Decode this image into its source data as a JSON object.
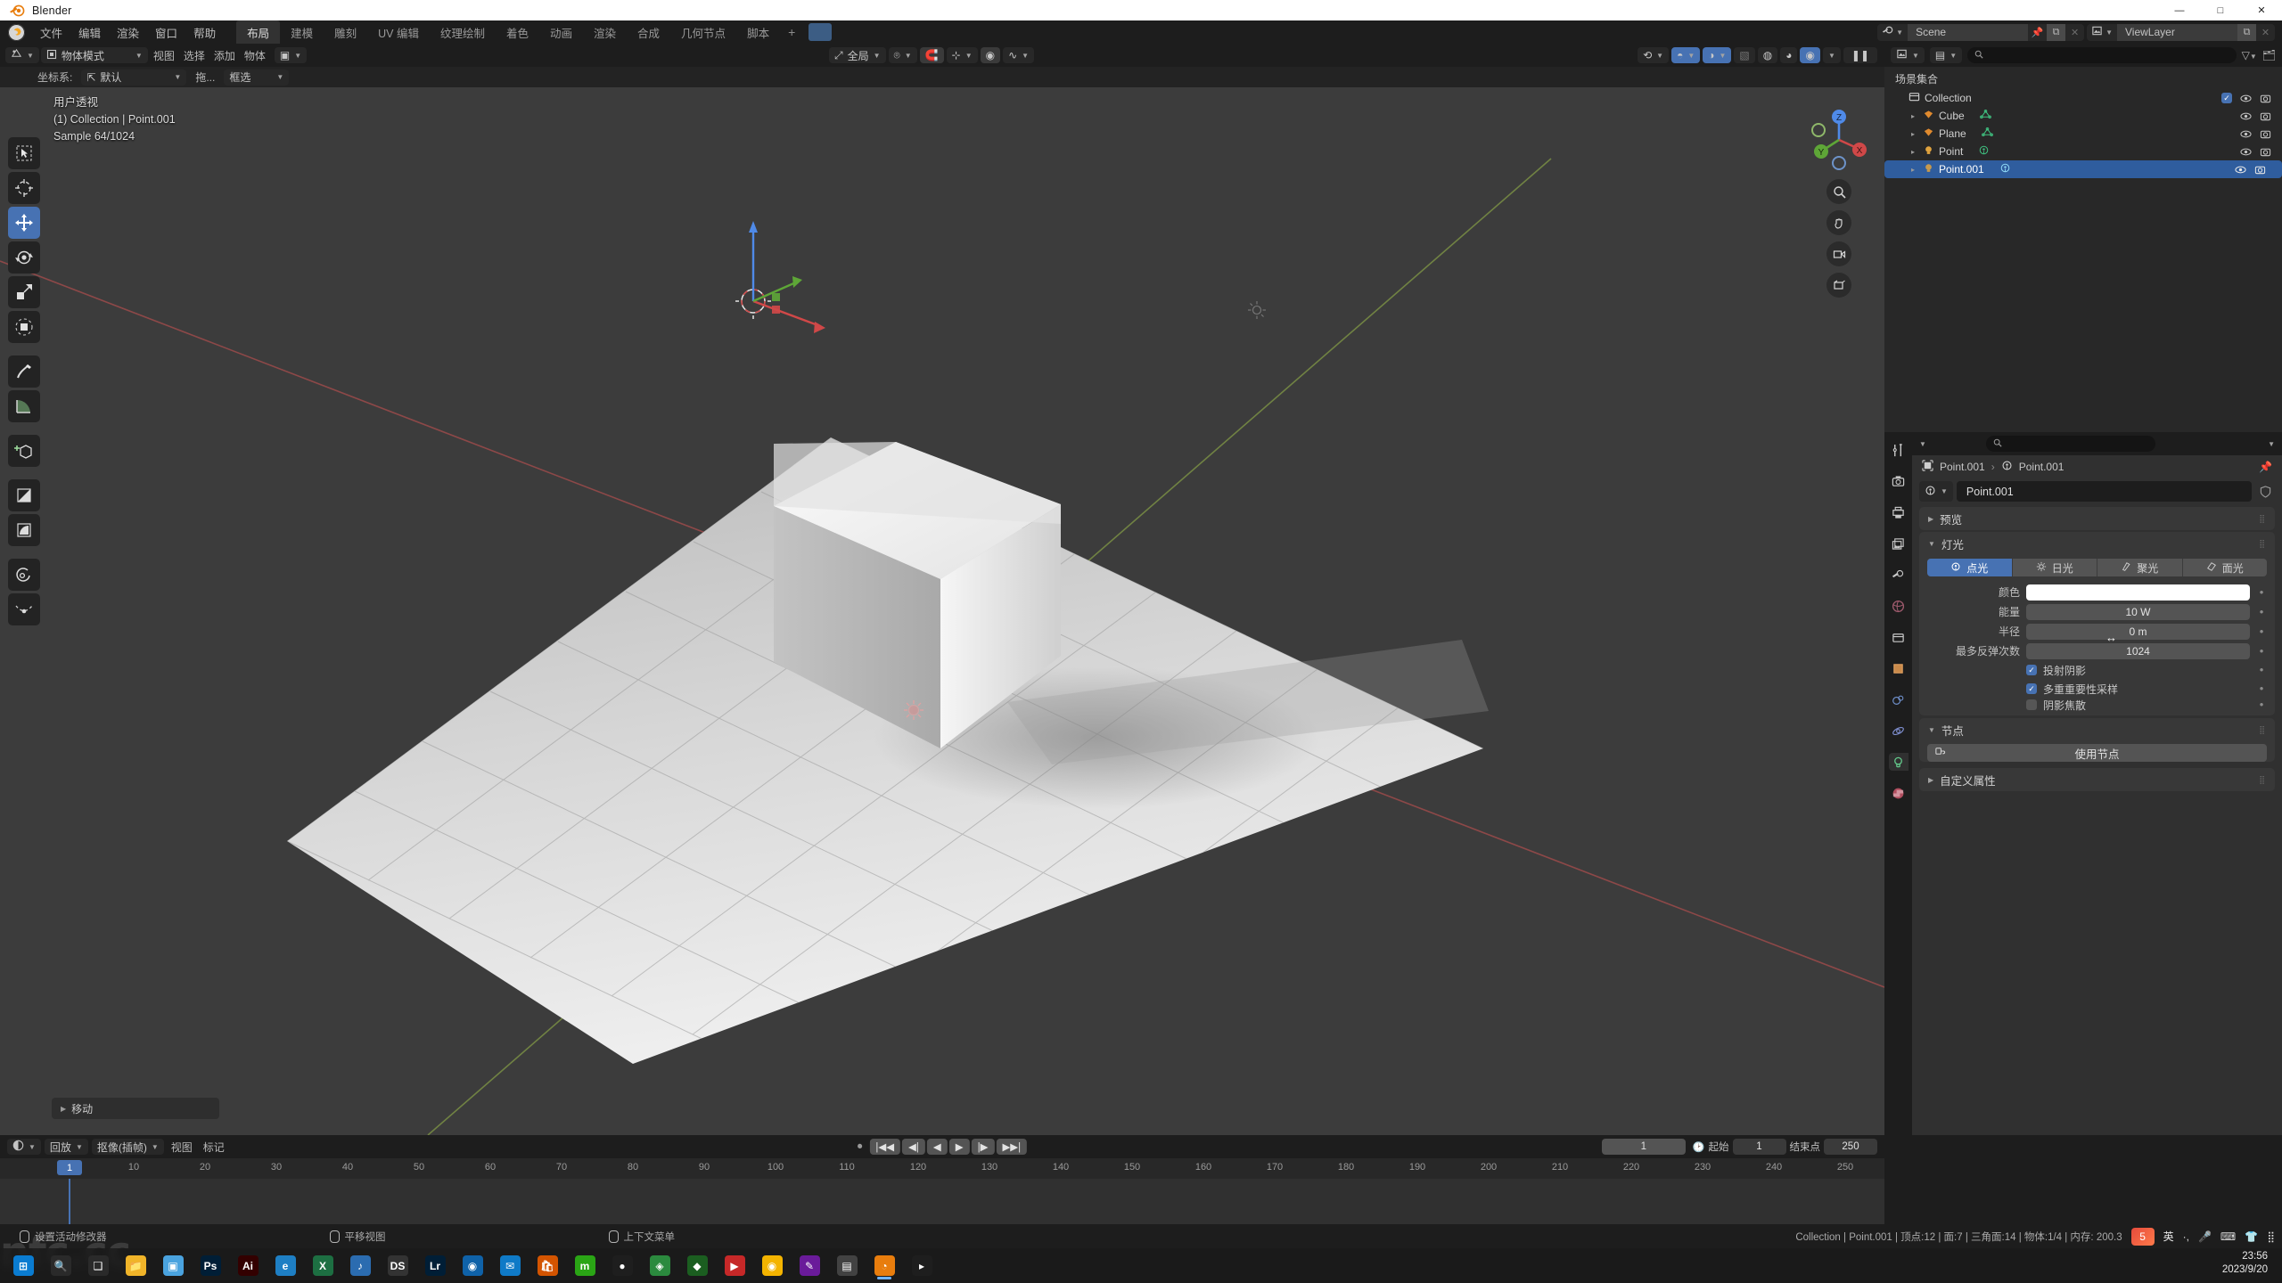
{
  "window": {
    "app_title": "Blender",
    "min": "—",
    "max": "□",
    "close": "✕"
  },
  "topbar": {
    "menus": [
      "文件",
      "编辑",
      "渲染",
      "窗口",
      "帮助"
    ],
    "workspaces": [
      "布局",
      "建模",
      "雕刻",
      "UV 编辑",
      "纹理绘制",
      "着色",
      "动画",
      "渲染",
      "合成",
      "几何节点",
      "脚本"
    ],
    "active_workspace": "布局",
    "add_workspace": "+",
    "scene_name": "Scene",
    "viewlayer_name": "ViewLayer",
    "scene_icon": "scene-icon",
    "viewlayer_icon": "viewlayer-icon",
    "pin_icon": "pin-icon",
    "copy_icon": "duplicate-icon",
    "x_icon": "unlink-icon"
  },
  "viewport": {
    "header": {
      "editor_type": "editor-type-3dview",
      "mode": "物体模式",
      "menus": [
        "视图",
        "选择",
        "添加",
        "物体"
      ],
      "transform_orientation": "全局",
      "snap_icon": "magnet-icon",
      "proportional_icon": "proportional-edit-icon"
    },
    "tool_header": {
      "orient_label": "坐标系:",
      "orient_value": "默认",
      "drag_label": "拖...",
      "drag_value": "框选"
    },
    "shading": {
      "overlays_icon": "overlays-icon",
      "xray_icon": "xray-icon",
      "gizmo_icon": "gizmo-icon",
      "wireframe_icon": "shading-wireframe",
      "solid_icon": "shading-solid",
      "material_icon": "shading-material",
      "rendered_icon": "shading-rendered",
      "pause_icon": "pause-render-icon"
    },
    "overlay_text": {
      "view_name": "用户透视",
      "collection_object": "(1) Collection | Point.001",
      "samples": "Sample 64/1024"
    },
    "tools": [
      {
        "name": "tweak-tool",
        "icon": "cursor-select-box",
        "active": false
      },
      {
        "name": "cursor-tool",
        "icon": "3d-cursor",
        "active": false
      },
      {
        "name": "move-tool",
        "icon": "move-arrows",
        "active": true
      },
      {
        "name": "rotate-tool",
        "icon": "rotate-arrows",
        "active": false
      },
      {
        "name": "scale-tool",
        "icon": "scale-corner",
        "active": false
      },
      {
        "name": "transform-tool",
        "icon": "transform-all",
        "active": false
      },
      {
        "name": "annotate-tool",
        "icon": "pencil",
        "active": false
      },
      {
        "name": "measure-tool",
        "icon": "ruler",
        "active": false
      },
      {
        "name": "add-cube-tool",
        "icon": "add-cube",
        "active": false
      },
      {
        "name": "shear-tool",
        "icon": "shear",
        "active": false
      },
      {
        "name": "to-sphere-tool",
        "icon": "to-sphere",
        "active": false
      },
      {
        "name": "spin-tool",
        "icon": "spin",
        "active": false
      },
      {
        "name": "bend-tool",
        "icon": "bend",
        "active": false
      }
    ],
    "gizmo_axes": [
      "X",
      "Y",
      "Z"
    ],
    "nav_buttons": [
      "zoom-icon",
      "pan-hand-icon",
      "camera-view-icon",
      "ortho-persp-icon"
    ],
    "operator_panel": "移动"
  },
  "outliner": {
    "display_mode_icon": "outliner-display-mode",
    "search_placeholder": "",
    "filter_icon": "filter-icon",
    "new_collection_icon": "new-collection-icon",
    "root_label": "场景集合",
    "items": [
      {
        "name": "Collection",
        "icon": "collection-icon",
        "indent": 0,
        "selected": false,
        "has_checkbox": true,
        "disclosure": ""
      },
      {
        "name": "Cube",
        "icon": "mesh-object-icon",
        "data_icon": "mesh-data-icon",
        "indent": 1,
        "selected": false,
        "disclosure": "▸"
      },
      {
        "name": "Plane",
        "icon": "mesh-object-icon",
        "data_icon": "mesh-data-icon",
        "indent": 1,
        "selected": false,
        "disclosure": "▸"
      },
      {
        "name": "Point",
        "icon": "light-object-icon",
        "data_icon": "light-data-icon",
        "indent": 1,
        "selected": false,
        "disclosure": "▸"
      },
      {
        "name": "Point.001",
        "icon": "light-object-icon",
        "data_icon": "light-data-icon",
        "indent": 1,
        "selected": true,
        "disclosure": "▸"
      }
    ]
  },
  "properties": {
    "tabs": [
      {
        "name": "tool-tab",
        "icon": "wrench-screwdriver-icon",
        "active": false
      },
      {
        "name": "render-tab",
        "icon": "camera-back-icon",
        "active": false
      },
      {
        "name": "output-tab",
        "icon": "printer-icon",
        "active": false
      },
      {
        "name": "viewlayer-tab",
        "icon": "images-icon",
        "active": false
      },
      {
        "name": "scene-tab",
        "icon": "scene-cone-icon",
        "active": false
      },
      {
        "name": "world-tab",
        "icon": "world-globe-icon",
        "active": false
      },
      {
        "name": "collection-tab",
        "icon": "collection-box-icon",
        "active": false
      },
      {
        "name": "object-tab",
        "icon": "object-square-icon",
        "active": false
      },
      {
        "name": "modifier-tab",
        "icon": "wrench-icon",
        "active": false
      },
      {
        "name": "physics-tab",
        "icon": "physics-orbit-icon",
        "active": false
      },
      {
        "name": "data-tab",
        "icon": "light-bulb-icon",
        "active": true
      },
      {
        "name": "material-tab",
        "icon": "checker-sphere-icon",
        "active": false
      }
    ],
    "search_placeholder": "",
    "breadcrumb_object": "Point.001",
    "breadcrumb_data": "Point.001",
    "id_name": "Point.001",
    "shield_icon": "fake-user-icon",
    "panels": {
      "preview": {
        "label": "预览",
        "expanded": false
      },
      "light": {
        "label": "灯光",
        "expanded": true
      },
      "nodes": {
        "label": "节点",
        "expanded": true
      },
      "custom_props": {
        "label": "自定义属性",
        "expanded": false
      }
    },
    "light_types": [
      {
        "label": "点光",
        "icon": "point-light-icon",
        "active": true
      },
      {
        "label": "日光",
        "icon": "sun-light-icon",
        "active": false
      },
      {
        "label": "聚光",
        "icon": "spot-light-icon",
        "active": false
      },
      {
        "label": "面光",
        "icon": "area-light-icon",
        "active": false
      }
    ],
    "fields": [
      {
        "label": "颜色",
        "value": "",
        "type": "color",
        "color": "#ffffff"
      },
      {
        "label": "能量",
        "value": "10 W",
        "type": "number"
      },
      {
        "label": "半径",
        "value": "0 m",
        "type": "number"
      },
      {
        "label": "最多反弹次数",
        "value": "1024",
        "type": "number"
      }
    ],
    "checkboxes": [
      {
        "label": "投射阴影",
        "checked": true
      },
      {
        "label": "多重重要性采样",
        "checked": true
      },
      {
        "label": "阴影焦散",
        "checked": false
      }
    ],
    "use_nodes_button": "使用节点"
  },
  "timeline": {
    "editor_icon": "timeline-editor-icon",
    "menus": [
      "回放",
      "抠像(插帧)",
      "视图",
      "标记"
    ],
    "ticks": [
      1,
      10,
      20,
      30,
      40,
      50,
      60,
      70,
      80,
      90,
      100,
      110,
      120,
      130,
      140,
      150,
      160,
      170,
      180,
      190,
      200,
      210,
      220,
      230,
      240,
      250
    ],
    "current_frame": 1,
    "current_frame_field": "1",
    "start_label": "起始",
    "start_value": "1",
    "end_label": "结束点",
    "end_value": "250",
    "playback_icons": [
      "jump-start",
      "prev-keyframe",
      "play-reverse",
      "play",
      "next-keyframe",
      "jump-end"
    ]
  },
  "statusbar": {
    "items": [
      {
        "icon": "mouse-left-icon",
        "label": "设置活动修改器"
      },
      {
        "icon": "mouse-middle-icon",
        "label": "平移视图"
      },
      {
        "icon": "mouse-right-icon",
        "label": "上下文菜单"
      }
    ],
    "scene_stats": "Collection | Point.001 | 顶点:12 | 面:7 | 三角面:14 | 物体:1/4 | 内存: 200.3",
    "ime": "英",
    "version": ""
  },
  "taskbar": {
    "items": [
      {
        "name": "start-button",
        "glyph": "⊞",
        "color": "#0a7cd1"
      },
      {
        "name": "search-button",
        "glyph": "🔍",
        "color": "#2a2a2a"
      },
      {
        "name": "taskview-button",
        "glyph": "❑",
        "color": "#2a2a2a"
      },
      {
        "name": "explorer-app",
        "glyph": "📁",
        "color": "#f0b429"
      },
      {
        "name": "gallery-app",
        "glyph": "▣",
        "color": "#4aa3df"
      },
      {
        "name": "photoshop-app",
        "glyph": "Ps",
        "color": "#001e36"
      },
      {
        "name": "illustrator-app",
        "glyph": "Ai",
        "color": "#330000"
      },
      {
        "name": "edge-app",
        "glyph": "e",
        "color": "#1e7fc4"
      },
      {
        "name": "excel-app",
        "glyph": "X",
        "color": "#1d6f42"
      },
      {
        "name": "music-app",
        "glyph": "♪",
        "color": "#2b6cb0"
      },
      {
        "name": "ds-app",
        "glyph": "DS",
        "color": "#333333"
      },
      {
        "name": "lightroom-app",
        "glyph": "Lr",
        "color": "#001e36"
      },
      {
        "name": "firefox-app",
        "glyph": "◉",
        "color": "#0f62a8"
      },
      {
        "name": "mail-app",
        "glyph": "✉",
        "color": "#0f7ac7"
      },
      {
        "name": "store-app",
        "glyph": "🛍",
        "color": "#d35400"
      },
      {
        "name": "wechat-app",
        "glyph": "m",
        "color": "#2aa515"
      },
      {
        "name": "qq-app",
        "glyph": "●",
        "color": "#1e1e1e"
      },
      {
        "name": "maps-app",
        "glyph": "◈",
        "color": "#2b8a3e"
      },
      {
        "name": "nav-app",
        "glyph": "◆",
        "color": "#1b5e20"
      },
      {
        "name": "video-app",
        "glyph": "▶",
        "color": "#c62828"
      },
      {
        "name": "chrome-app",
        "glyph": "◉",
        "color": "#f4b400"
      },
      {
        "name": "pen-app",
        "glyph": "✎",
        "color": "#6a1b9a"
      },
      {
        "name": "notes-app",
        "glyph": "▤",
        "color": "#424242"
      },
      {
        "name": "blender-app",
        "glyph": "◔",
        "color": "#e87d0d",
        "active": true
      },
      {
        "name": "terminal-app",
        "glyph": "▸",
        "color": "#1e1e1e"
      }
    ],
    "clock_time": "23:56",
    "clock_date": "2023/9/20"
  }
}
